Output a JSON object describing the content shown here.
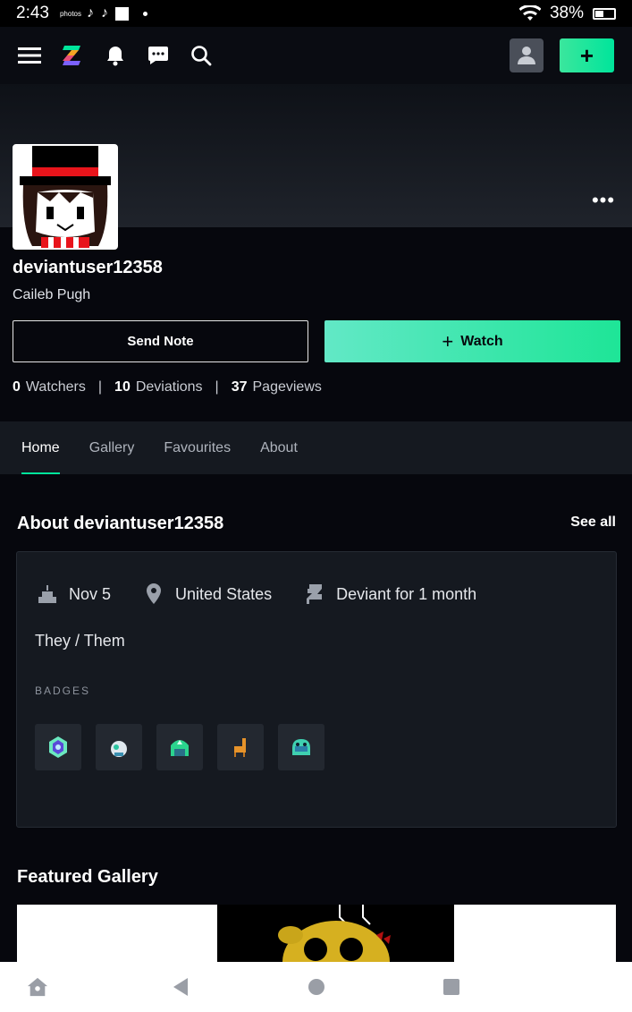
{
  "status_bar": {
    "time": "2:43",
    "photos_label": "photos",
    "battery": "38%"
  },
  "nav": {
    "icons": [
      "menu-icon",
      "deviantart-logo-icon",
      "bell-icon",
      "chat-icon",
      "search-icon"
    ],
    "create_label": "+"
  },
  "profile": {
    "username": "deviantuser12358",
    "real_name": "Caileb Pugh",
    "more_label": "•••",
    "send_note_label": "Send Note",
    "watch_label": "Watch",
    "watch_plus": "+"
  },
  "stats": {
    "watchers_count": "0",
    "watchers_label": "Watchers",
    "deviations_count": "10",
    "deviations_label": "Deviations",
    "pageviews_count": "37",
    "pageviews_label": "Pageviews",
    "separator": "|"
  },
  "tabs": [
    {
      "label": "Home",
      "active": true
    },
    {
      "label": "Gallery",
      "active": false
    },
    {
      "label": "Favourites",
      "active": false
    },
    {
      "label": "About",
      "active": false
    }
  ],
  "about": {
    "title": "About deviantuser12358",
    "see_all": "See all",
    "birthday": "Nov 5",
    "location": "United States",
    "membership": "Deviant for 1 month",
    "pronouns": "They / Them",
    "badges_label": "BADGES",
    "badges": [
      "badge-1",
      "badge-2",
      "badge-3",
      "badge-4",
      "badge-5"
    ]
  },
  "featured": {
    "title": "Featured Gallery"
  },
  "colors": {
    "accent": "#00e59b",
    "background": "#06070d",
    "card": "#151920"
  }
}
